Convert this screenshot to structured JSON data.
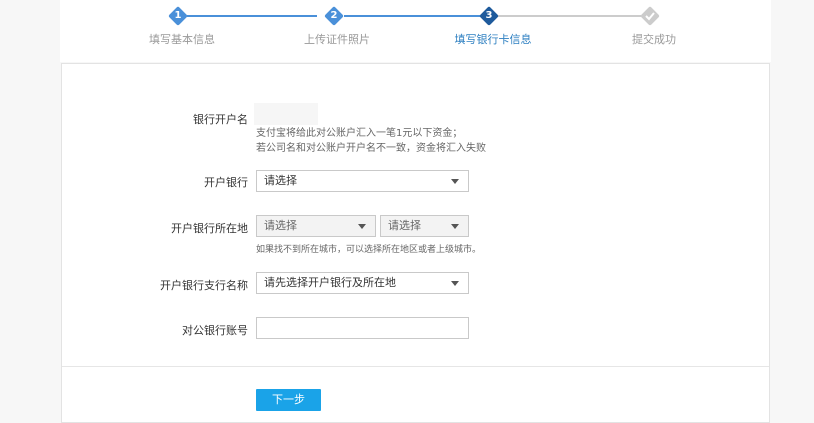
{
  "steps": [
    {
      "num": "1",
      "label": "填写基本信息",
      "state": "done"
    },
    {
      "num": "2",
      "label": "上传证件照片",
      "state": "done"
    },
    {
      "num": "3",
      "label": "填写银行卡信息",
      "state": "current"
    },
    {
      "num": "",
      "label": "提交成功",
      "state": "pending"
    }
  ],
  "colors": {
    "step_done": "#4a90d9",
    "step_current": "#1e5a9c",
    "step_pending": "#cccccc",
    "primary_button": "#1aa3e8"
  },
  "icons": {
    "step4": "check-icon",
    "dropdown": "triangle-down-icon"
  },
  "form": {
    "account_name": {
      "label": "银行开户名",
      "value": "",
      "note_line1": "支付宝将给此对公账户汇入一笔1元以下资金；",
      "note_line2": "若公司名和对公账户开户名不一致，资金将汇入失败"
    },
    "bank": {
      "label": "开户银行",
      "selected": "请选择"
    },
    "bank_location": {
      "label": "开户银行所在地",
      "province_selected": "请选择",
      "city_selected": "请选择",
      "hint": "如果找不到所在城市，可以选择所在地区或者上级城市。"
    },
    "branch": {
      "label": "开户银行支行名称",
      "selected": "请先选择开户银行及所在地"
    },
    "account_number": {
      "label": "对公银行账号",
      "value": ""
    }
  },
  "next_button": "下一步"
}
